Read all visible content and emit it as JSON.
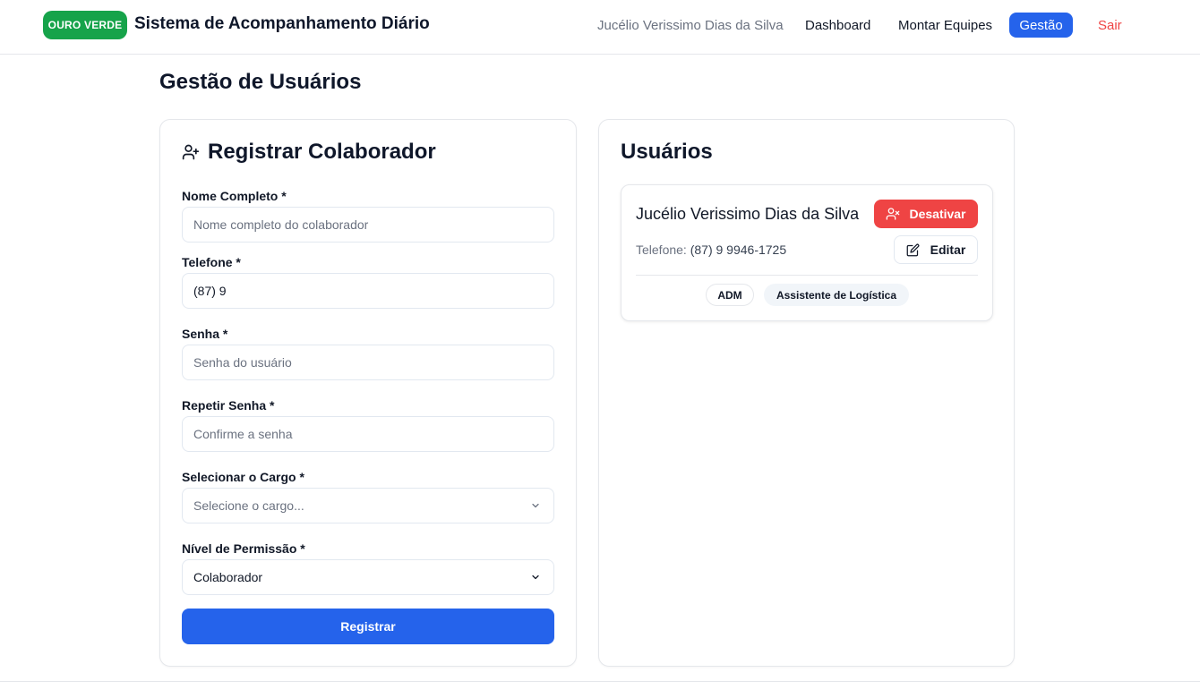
{
  "header": {
    "brand_badge": "OURO VERDE",
    "app_title": "Sistema de Acompanhamento Diário",
    "nav": {
      "user_name": "Jucélio Verissimo Dias da Silva",
      "dashboard": "Dashboard",
      "montar_equipes": "Montar Equipes",
      "gestao": "Gestão",
      "sair": "Sair"
    },
    "colors": {
      "brand": "#16a34a",
      "active_nav": "#2563eb",
      "logout": "#ef4444"
    }
  },
  "page": {
    "title": "Gestão de Usuários"
  },
  "register_form": {
    "title": "Registrar Colaborador",
    "icon": "user-plus-icon",
    "fields": {
      "nome": {
        "label": "Nome Completo *",
        "value": "",
        "placeholder": "Nome completo do colaborador"
      },
      "telefone": {
        "label": "Telefone *",
        "value": "(87) 9",
        "placeholder": ""
      },
      "senha": {
        "label": "Senha *",
        "value": "",
        "placeholder": "Senha do usuário"
      },
      "repetir_senha": {
        "label": "Repetir Senha *",
        "value": "",
        "placeholder": "Confirme a senha"
      },
      "cargo": {
        "label": "Selecionar o Cargo *",
        "placeholder": "Selecione o cargo..."
      },
      "permissao": {
        "label": "Nível de Permissão *",
        "value": "Colaborador"
      }
    },
    "submit_label": "Registrar"
  },
  "users_panel": {
    "title": "Usuários",
    "users": [
      {
        "name": "Jucélio Verissimo Dias da Silva",
        "phone_label": "Telefone:",
        "phone": "(87) 9 9946-1725",
        "deactivate_label": "Desativar",
        "edit_label": "Editar",
        "badges": [
          "ADM",
          "Assistente de Logística"
        ]
      }
    ],
    "colors": {
      "deactivate": "#ef4444"
    }
  }
}
